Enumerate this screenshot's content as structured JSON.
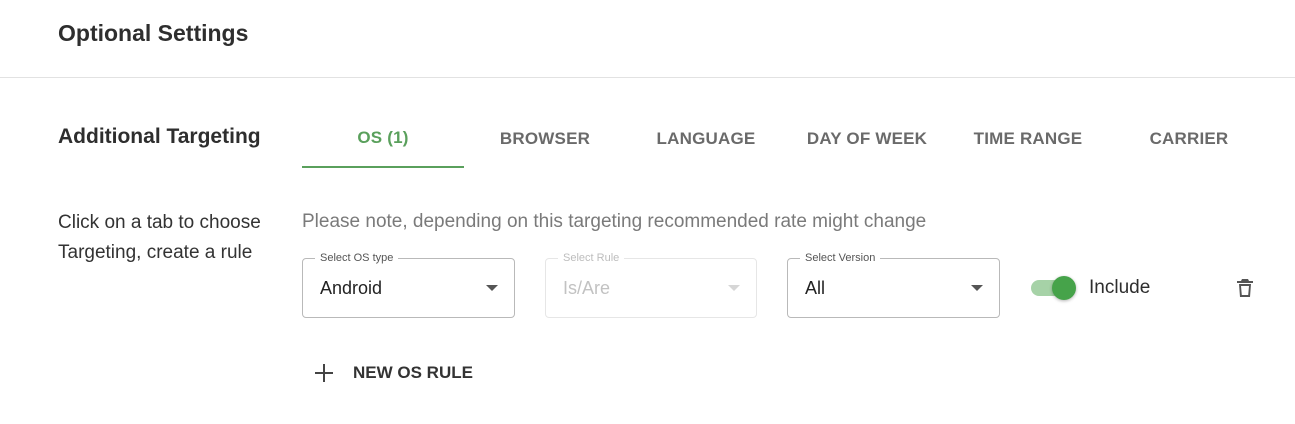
{
  "header": {
    "title": "Optional Settings"
  },
  "section": {
    "title": "Additional Targeting"
  },
  "tabs": [
    {
      "label": "OS (1)",
      "active": true
    },
    {
      "label": "BROWSER",
      "active": false
    },
    {
      "label": "LANGUAGE",
      "active": false
    },
    {
      "label": "DAY OF WEEK",
      "active": false
    },
    {
      "label": "TIME RANGE",
      "active": false
    },
    {
      "label": "CARRIER",
      "active": false
    }
  ],
  "help_text": "Click on a tab to choose Targeting, create a rule",
  "note": "Please note, depending on this targeting recommended rate might change",
  "rule": {
    "os_type": {
      "label": "Select OS type",
      "value": "Android",
      "disabled": false
    },
    "rule": {
      "label": "Select Rule",
      "value": "Is/Are",
      "disabled": true
    },
    "version": {
      "label": "Select Version",
      "value": "All",
      "disabled": false
    },
    "toggle": {
      "label": "Include",
      "on": true
    },
    "delete_icon": "trash-icon"
  },
  "new_rule": {
    "label": "NEW OS RULE",
    "icon": "plus-icon"
  },
  "colors": {
    "accent": "#5aa05c",
    "toggle_thumb": "#46a34a",
    "toggle_track": "#a6d2a7",
    "tab_inactive": "#6a6a6a",
    "note_text": "#7a7a7a"
  }
}
